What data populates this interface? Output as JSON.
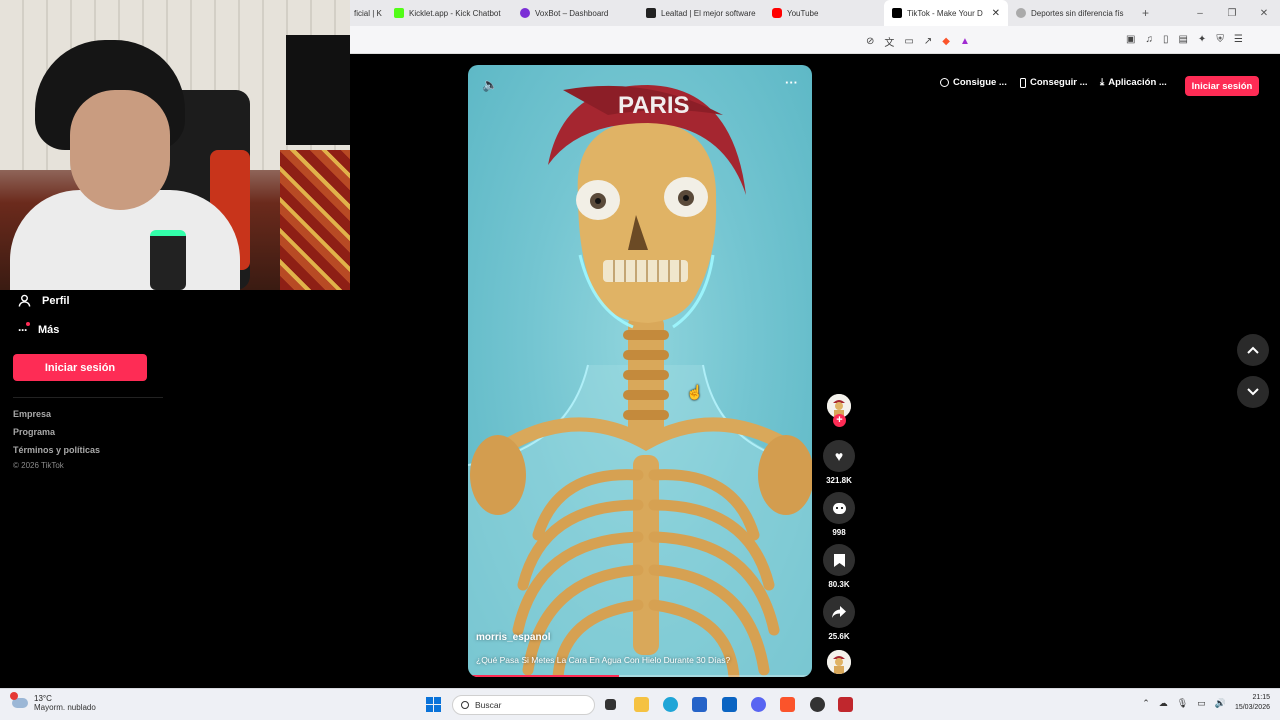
{
  "browser": {
    "tabs": [
      {
        "label": "ficial | K",
        "color": "#5a5a5a"
      },
      {
        "label": "Kicklet.app - Kick Chatbot",
        "color": "#53fc18"
      },
      {
        "label": "VoxBot – Dashboard",
        "color": "#7b2fd6"
      },
      {
        "label": "Lealtad | El mejor software",
        "color": "#222222"
      },
      {
        "label": "YouTube",
        "color": "#ff0000"
      },
      {
        "label": "TikTok - Make Your Day",
        "color": "#000000",
        "active": true
      },
      {
        "label": "Deportes sin diferencia fís",
        "color": "#888888"
      }
    ],
    "new_tab": "+",
    "window_controls": [
      "–",
      "❐",
      "✕"
    ]
  },
  "sidebar": {
    "profile_label": "Perfil",
    "more_label": "Más",
    "login_button": "Iniciar sesión",
    "links": [
      "Empresa",
      "Programa",
      "Términos y políticas"
    ],
    "copyright": "© 2026 TikTok"
  },
  "header": {
    "items": [
      {
        "icon": "coin-icon",
        "label": "Consigue ..."
      },
      {
        "icon": "phone-icon",
        "label": "Conseguir ..."
      },
      {
        "icon": "download-icon",
        "label": "Aplicación ..."
      }
    ],
    "login_button": "Iniciar sesión"
  },
  "video": {
    "username": "morris_espanol",
    "caption": "¿Qué Pasa Si Metes La Cara En Agua Con Hielo Durante 30 Días?",
    "cap_text": "PARIS",
    "progress": 0.44
  },
  "actions": {
    "likes": "321.8K",
    "comments": "998",
    "saves": "80.3K",
    "shares": "25.6K"
  },
  "taskbar": {
    "weather_temp": "13°C",
    "weather_desc": "Mayorm. nublado",
    "search_placeholder": "Buscar",
    "time": "21:15",
    "date": "15/03/2026"
  },
  "colors": {
    "accent": "#fe2c55",
    "video_bg": "#74c5d1"
  }
}
